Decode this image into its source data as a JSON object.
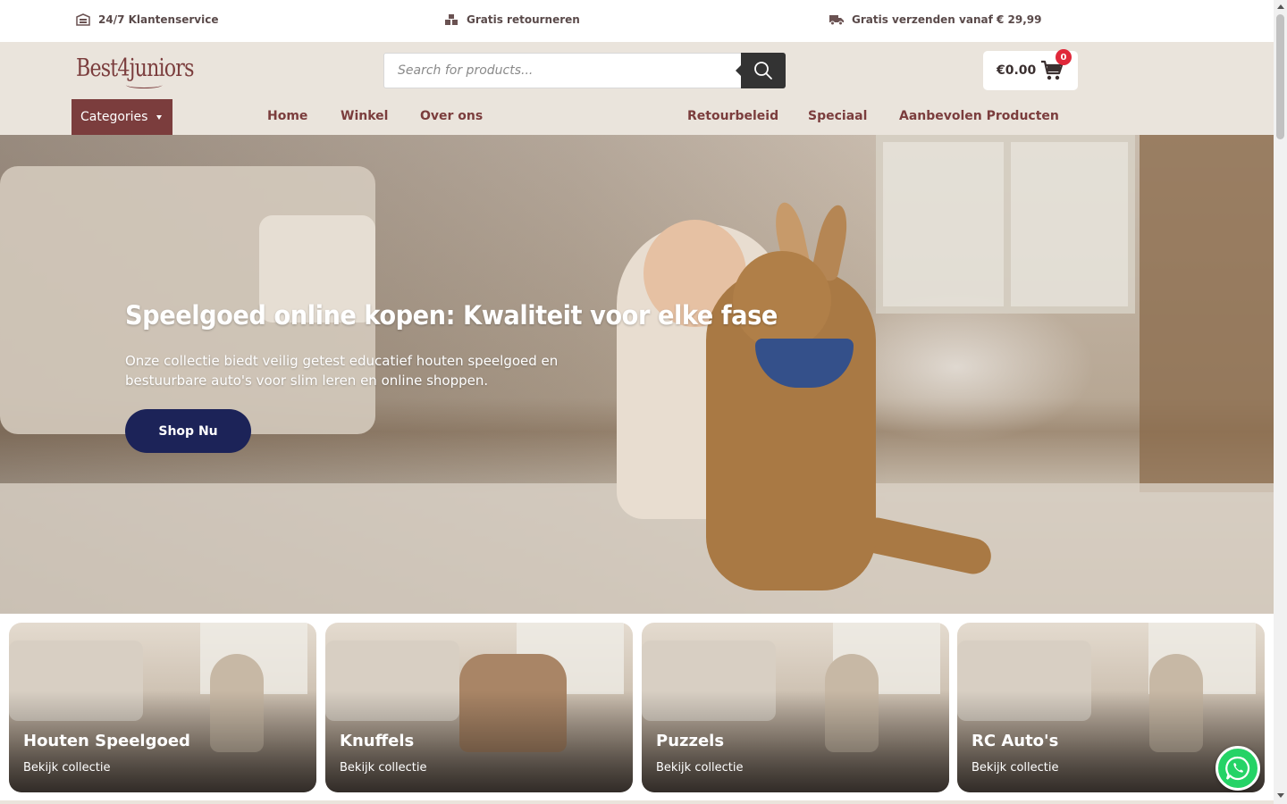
{
  "topbar": {
    "items": [
      {
        "label": "24/7 Klantenservice",
        "icon": "store-icon"
      },
      {
        "label": "Gratis retourneren",
        "icon": "boxes-icon"
      },
      {
        "label": "Gratis verzenden vanaf € 29,99",
        "icon": "truck-icon"
      }
    ]
  },
  "header": {
    "logo_text": "Best4juniors",
    "search_placeholder": "Search for products...",
    "cart_amount": "€0.00",
    "cart_count": "0",
    "categories_label": "Categories",
    "nav": [
      "Home",
      "Winkel",
      "Over ons",
      "Retourbeleid",
      "Speciaal",
      "Aanbevolen Producten"
    ]
  },
  "hero": {
    "title": "Speelgoed online kopen: Kwaliteit voor elke fase",
    "text": "Onze collectie biedt veilig getest educatief houten speelgoed en bestuurbare auto's voor slim leren en online shoppen.",
    "button": "Shop Nu"
  },
  "cards": [
    {
      "title": "Houten Speelgoed",
      "sub": "Bekijk collectie"
    },
    {
      "title": "Knuffels",
      "sub": "Bekijk collectie"
    },
    {
      "title": "Puzzels",
      "sub": "Bekijk collectie"
    },
    {
      "title": "RC Auto's",
      "sub": "Bekijk collectie"
    }
  ],
  "colors": {
    "brand": "#7b3d3d",
    "header_bg": "#eae4dc",
    "cta": "#1c2358",
    "badge": "#e0283a",
    "whatsapp": "#25d366"
  }
}
